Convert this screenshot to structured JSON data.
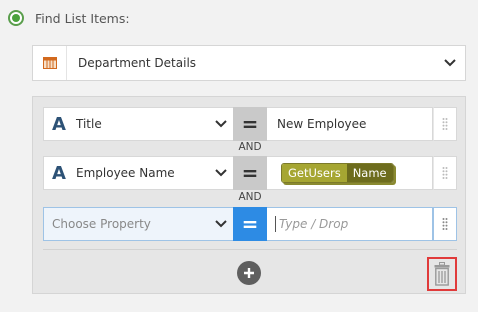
{
  "header": {
    "label": "Find List Items:"
  },
  "list": {
    "selected": "Department Details"
  },
  "rows": [
    {
      "property": "Title",
      "value": "New Employee"
    },
    {
      "property": "Employee Name",
      "token": [
        "GetUsers",
        "Name"
      ]
    },
    {
      "property_placeholder": "Choose Property",
      "value_placeholder": "Type / Drop"
    }
  ],
  "conjunctions": [
    "AND",
    "AND"
  ],
  "operator_glyph": "=",
  "type_glyph": "A",
  "colors": {
    "accent_blue": "#2d8be4",
    "radio_green": "#4aa23c",
    "token_olive": "#a6a632",
    "delete_red": "#e03a3a",
    "type_icon": "#2d5276"
  },
  "icons": {
    "list": "list-table-icon",
    "chevron": "chevron-down-icon",
    "grip": "drag-grip-icon",
    "add": "plus-circle-icon",
    "delete": "trash-icon"
  }
}
